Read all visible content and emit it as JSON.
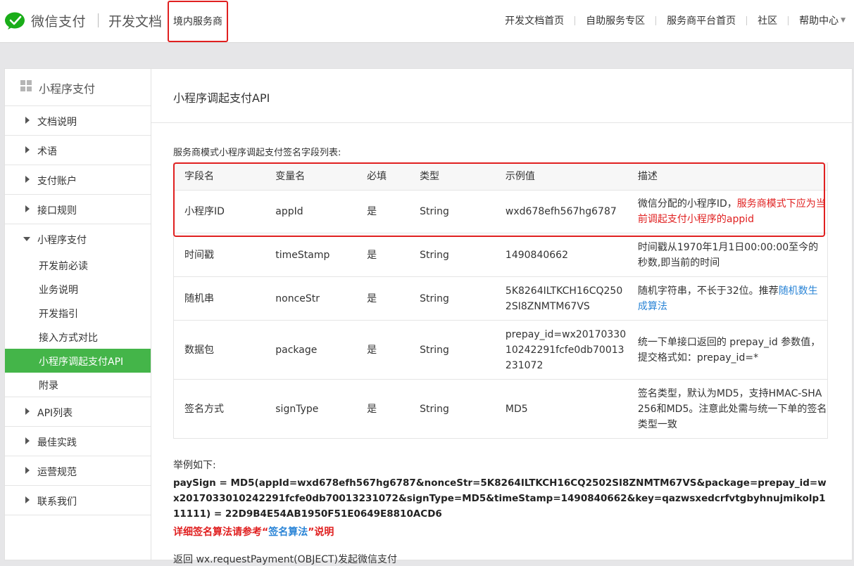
{
  "header": {
    "brand": "微信支付",
    "docs_title": "开发文档",
    "region": "境内服务商",
    "nav": [
      "开发文档首页",
      "自助服务专区",
      "服务商平台首页",
      "社区",
      "帮助中心"
    ]
  },
  "sidebar": {
    "title": "小程序支付",
    "items": [
      {
        "label": "文档说明"
      },
      {
        "label": "术语"
      },
      {
        "label": "支付账户"
      },
      {
        "label": "接口规则"
      },
      {
        "label": "小程序支付"
      }
    ],
    "sub_items": [
      {
        "label": "开发前必读"
      },
      {
        "label": "业务说明"
      },
      {
        "label": "开发指引"
      },
      {
        "label": "接入方式对比"
      },
      {
        "label": "小程序调起支付API"
      },
      {
        "label": "附录"
      }
    ],
    "items_after": [
      {
        "label": "API列表"
      },
      {
        "label": "最佳实践"
      },
      {
        "label": "运营规范"
      },
      {
        "label": "联系我们"
      }
    ]
  },
  "main": {
    "title": "小程序调起支付API",
    "intro": "服务商模式小程序调起支付签名字段列表:",
    "table": {
      "headers": [
        "字段名",
        "变量名",
        "必填",
        "类型",
        "示例值",
        "描述"
      ],
      "rows": [
        {
          "name": "小程序ID",
          "var": "appId",
          "req": "是",
          "type": "String",
          "example": "wxd678efh567hg6787",
          "desc": "微信分配的小程序ID，",
          "desc_red": "服务商模式下应为当前调起支付小程序的appid"
        },
        {
          "name": "时间戳",
          "var": "timeStamp",
          "req": "是",
          "type": "String",
          "example": "1490840662",
          "desc": "时间戳从1970年1月1日00:00:00至今的秒数,即当前的时间"
        },
        {
          "name": "随机串",
          "var": "nonceStr",
          "req": "是",
          "type": "String",
          "example": "5K8264ILTKCH16CQ2502SI8ZNMTM67VS",
          "desc": "随机字符串，不长于32位。推荐",
          "desc_link": "随机数生成算法"
        },
        {
          "name": "数据包",
          "var": "package",
          "req": "是",
          "type": "String",
          "example": "prepay_id=wx2017033010242291fcfe0db70013231072",
          "desc": "统一下单接口返回的 prepay_id 参数值，提交格式如：prepay_id=*"
        },
        {
          "name": "签名方式",
          "var": "signType",
          "req": "是",
          "type": "String",
          "example": "MD5",
          "desc": "签名类型，默认为MD5，支持HMAC-SHA256和MD5。注意此处需与统一下单的签名类型一致"
        }
      ]
    },
    "example_label": "举例如下:",
    "example_code": "paySign = MD5(appId=wxd678efh567hg6787&nonceStr=5K8264ILTKCH16CQ2502SI8ZNMTM67VS&package=prepay_id=wx2017033010242291fcfe0db70013231072&signType=MD5&timeStamp=1490840662&key=qazwsxedcrfvtgbyhnujmikolp111111) = 22D9B4E54AB1950F51E0649E8810ACD6",
    "note_prefix": "详细签名算法请参考“",
    "note_link": "签名算法",
    "note_suffix": "”说明",
    "cutoff_text": "返回 wx.requestPayment(OBJECT)发起微信支付"
  },
  "colors": {
    "accent_green": "#44b549",
    "highlight_red": "#e02020",
    "link_blue": "#2a84d6"
  },
  "icons": [
    "wechat-pay-logo-icon",
    "grid-icon",
    "chevron-down-icon"
  ]
}
